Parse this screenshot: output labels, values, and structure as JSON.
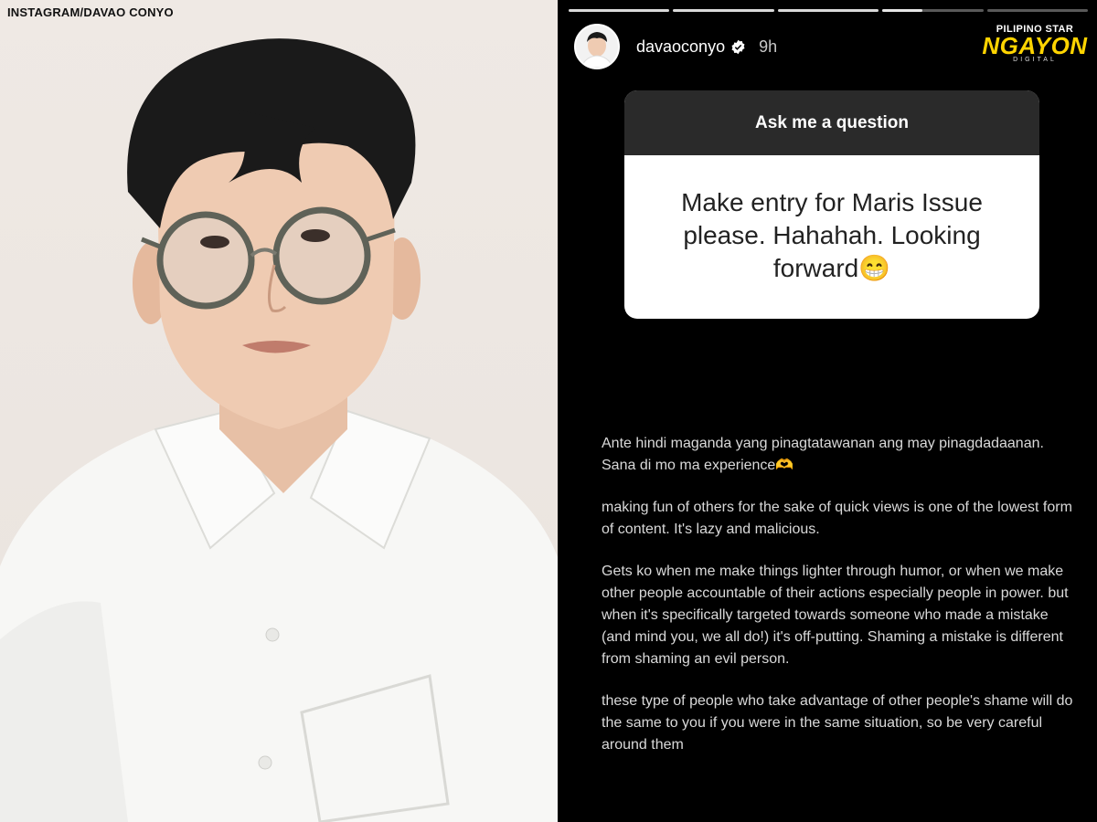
{
  "photo": {
    "credit": "INSTAGRAM/DAVAO CONYO"
  },
  "story": {
    "progress_segments": 5,
    "progress_current": 4,
    "username": "davaoconyo",
    "verified": true,
    "time": "9h",
    "brand": {
      "top": "PILIPINO STAR",
      "mid": "NGAYON",
      "bot": "DIGITAL"
    },
    "question": {
      "header": "Ask me a question",
      "text": "Make entry for Maris Issue please. Hahahah. Looking forward😁"
    },
    "reply_paragraphs": [
      "Ante hindi maganda yang pinagtatawanan ang may pinagdadaanan. Sana di mo ma experience🫶",
      "making fun of others for the sake of quick views is one of the lowest form of content. It's lazy and malicious.",
      "Gets ko when me make things lighter through humor, or when we make other people accountable of their actions especially people in power. but when it's  specifically  targeted towards someone who made a mistake (and mind you, we all do!) it's off-putting.  Shaming a mistake is different from shaming an evil person.",
      "these type of people who take advantage of other people's shame will do the same to you if you were in the same situation, so be very careful around them"
    ]
  },
  "colors": {
    "story_bg": "#000000",
    "card_header": "#2a2a2a",
    "brand_yellow": "#ffd400"
  },
  "icons": [
    "verified-badge-icon"
  ]
}
